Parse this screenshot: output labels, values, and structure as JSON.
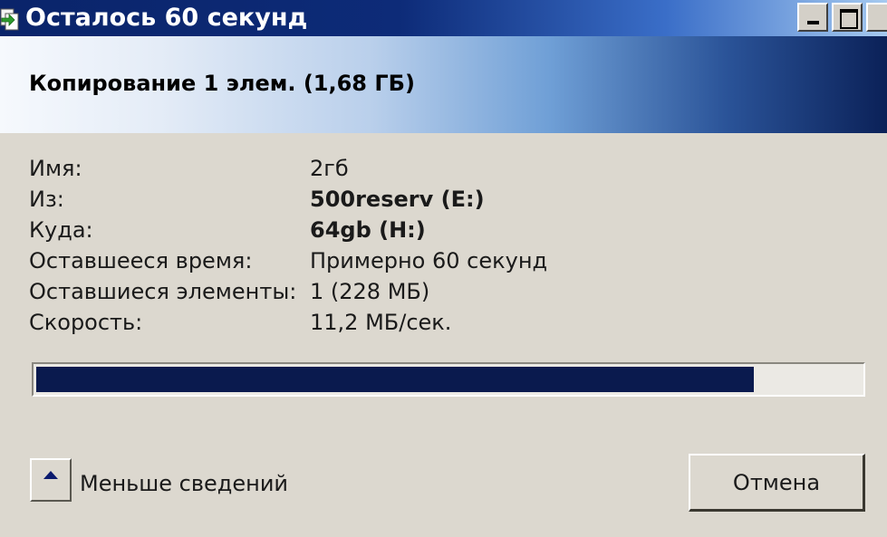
{
  "window": {
    "title": "Осталось 60 секунд",
    "buttons": {
      "minimize": "minimize",
      "maximize": "maximize",
      "close": "close"
    }
  },
  "header": {
    "title": "Копирование 1 элем. (1,68 ГБ)"
  },
  "details": {
    "rows": [
      {
        "label": "Имя:",
        "value": "2гб"
      },
      {
        "label": "Из:",
        "value": "500reserv (E:)"
      },
      {
        "label": "Куда:",
        "value": "64gb (H:)"
      },
      {
        "label": "Оставшееся время:",
        "value": "Примерно 60 секунд"
      },
      {
        "label": "Оставшиеся элементы:",
        "value": "1 (228 МБ)"
      },
      {
        "label": "Скорость:",
        "value": "11,2 МБ/сек."
      }
    ]
  },
  "progress": {
    "fraction": 0.87
  },
  "footer": {
    "less_details_label": "Меньше сведений",
    "cancel_label": "Отмена"
  },
  "colors": {
    "titlebar_start": "#0a246a",
    "progress_fill": "#0a1a4e",
    "dialog_bg": "#dcd8cf"
  },
  "icons": {
    "title": "copy-files-icon",
    "less_details": "arrow-up-icon"
  }
}
